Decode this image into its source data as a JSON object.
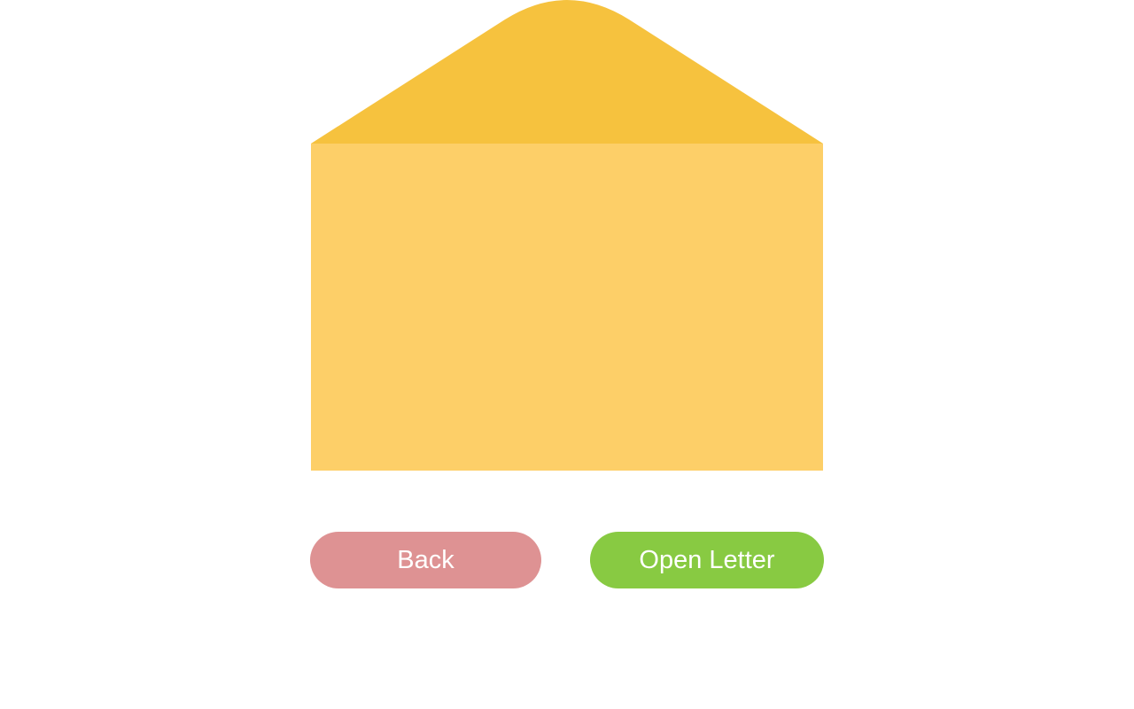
{
  "envelope": {
    "flap_color": "#F6C23E",
    "body_color": "#FDCF68"
  },
  "buttons": {
    "back_label": "Back",
    "back_color": "#DE9293",
    "open_label": "Open Letter",
    "open_color": "#88CA42"
  }
}
